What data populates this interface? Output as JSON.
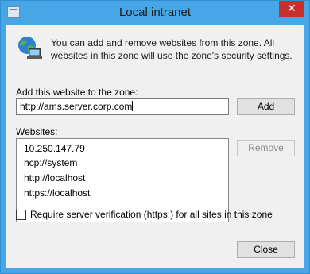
{
  "window": {
    "title": "Local intranet",
    "close_glyph": "✕"
  },
  "info": {
    "text": "You can add and remove websites from this zone. All websites in this zone will use the zone's security settings.",
    "icon": "globe-computer-icon"
  },
  "add": {
    "label": "Add this website to the zone:",
    "value": "http://ams.server.corp.com",
    "button": "Add"
  },
  "websites": {
    "label": "Websites:",
    "items": [
      "10.250.147.79",
      "hcp://system",
      "http://localhost",
      "https://localhost"
    ],
    "remove_button": "Remove"
  },
  "verify": {
    "label": "Require server verification (https:) for all sites in this zone",
    "checked": false
  },
  "footer": {
    "close_button": "Close"
  }
}
